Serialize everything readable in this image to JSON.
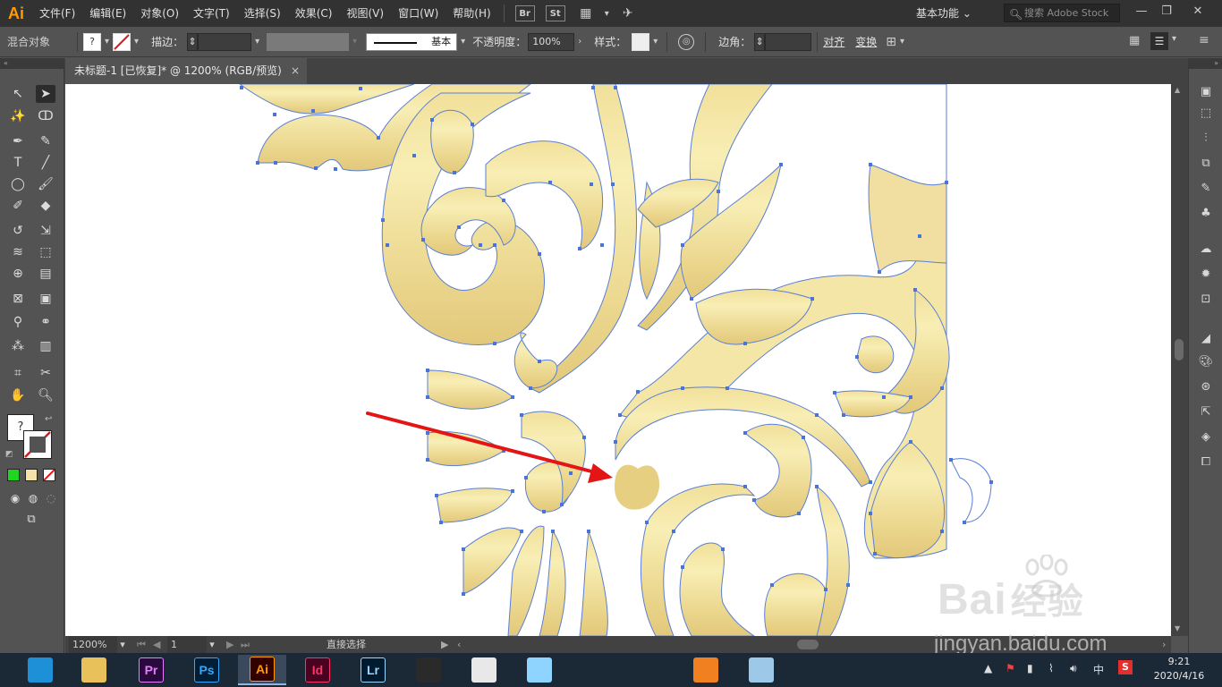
{
  "app": {
    "logo_text": "Ai",
    "menus": [
      "文件(F)",
      "编辑(E)",
      "对象(O)",
      "文字(T)",
      "选择(S)",
      "效果(C)",
      "视图(V)",
      "窗口(W)",
      "帮助(H)"
    ],
    "bridge_label": "Br",
    "stock_label": "St",
    "workspace": "基本功能",
    "search_placeholder": "搜索 Adobe Stock"
  },
  "control_bar": {
    "object_type": "混合对象",
    "stroke_label": "描边：",
    "stroke_profile": "基本",
    "opacity_label": "不透明度：",
    "opacity_value": "100%",
    "style_label": "样式：",
    "corner_label": "边角：",
    "align_label": "对齐",
    "transform_label": "变换"
  },
  "document": {
    "tab_title": "未标题-1 [已恢复]* @ 1200% (RGB/预览)",
    "close_glyph": "×"
  },
  "status_bar": {
    "zoom": "1200%",
    "artboard": "1",
    "tool_name": "直接选择"
  },
  "colors": {
    "ornament_fill": "#f2e3a0",
    "ornament_stroke": "#5a7fd4",
    "anchor": "#4a74d8",
    "arrow": "#e31515",
    "fill_swatch": "#ffffff",
    "accent": "#ff9a00"
  },
  "taskbar": {
    "apps": [
      {
        "label": "",
        "icon": "browser-360-icon",
        "color": "#1e90d8"
      },
      {
        "label": "",
        "icon": "file-explorer-icon",
        "color": "#e8c15a"
      },
      {
        "label": "Pr",
        "icon": "premiere-icon",
        "color": "#2a0a3e",
        "text": "#e77cff"
      },
      {
        "label": "Ps",
        "icon": "photoshop-icon",
        "color": "#001e36",
        "text": "#31a8ff"
      },
      {
        "label": "Ai",
        "icon": "illustrator-icon",
        "color": "#330000",
        "text": "#ff9a00"
      },
      {
        "label": "Id",
        "icon": "indesign-icon",
        "color": "#49021f",
        "text": "#ff3366"
      },
      {
        "label": "Lr",
        "icon": "lightroom-icon",
        "color": "#001a2e",
        "text": "#9ad6ff"
      },
      {
        "label": "",
        "icon": "video-editor-icon",
        "color": "#2a2a2a"
      },
      {
        "label": "",
        "icon": "umbrella-app-icon",
        "color": "#e8e8e8"
      },
      {
        "label": "",
        "icon": "cartoon-app-icon",
        "color": "#8fd4ff"
      },
      {
        "label": "",
        "icon": "qq-icon",
        "color": "#1b2836"
      },
      {
        "label": "",
        "icon": "chrome-icon",
        "color": "#1b2836"
      },
      {
        "label": "",
        "icon": "foxmail-icon",
        "color": "#f08020"
      },
      {
        "label": "",
        "icon": "notepad-icon",
        "color": "#9ec8e8"
      }
    ],
    "time": "9:21",
    "date": "2020/4/16",
    "ime": "中"
  },
  "watermark": {
    "brand": "Bai",
    "brand_cn": "经验",
    "url": "jingyan.baidu.com"
  }
}
